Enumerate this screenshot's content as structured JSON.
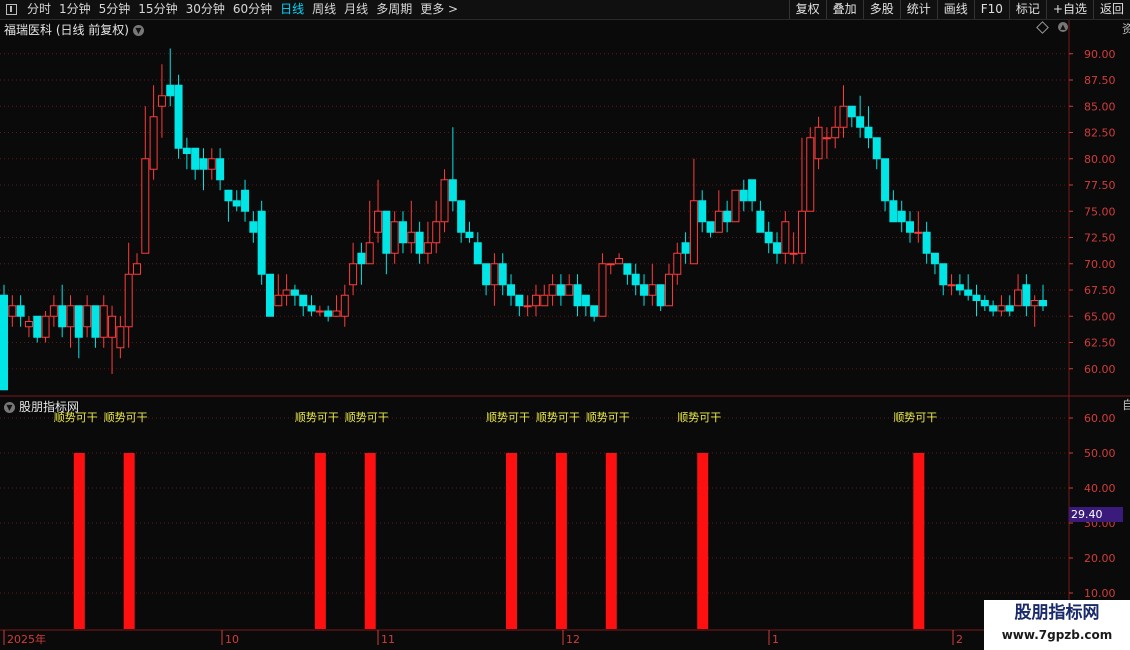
{
  "toolbar": {
    "periods": [
      "分时",
      "1分钟",
      "5分钟",
      "15分钟",
      "30分钟",
      "60分钟",
      "日线",
      "周线",
      "月线",
      "多周期",
      "更多 >"
    ],
    "active_period": "日线",
    "buttons": [
      "复权",
      "叠加",
      "多股",
      "统计",
      "画线",
      "F10",
      "标记",
      "+自选",
      "返回"
    ]
  },
  "chart_title": "福瑞医科 (日线 前复权)",
  "indicator_title": "股朋指标网",
  "current_value": "29.40",
  "side_text_top": "资",
  "side_text_bottom": "自",
  "watermark": {
    "title": "股朋指标网",
    "url": "www.7gpzb.com"
  },
  "colors": {
    "up": "#ff3b3b",
    "down": "#00e5e5",
    "grid": "#5a1a1a",
    "signal": "#ff1010",
    "signal_text": "#e8e84a"
  },
  "chart_data": [
    {
      "type": "candlestick",
      "title": "福瑞医科 (日线 前复权)",
      "y_ticks": [
        "90.00",
        "87.50",
        "85.00",
        "82.50",
        "80.00",
        "77.50",
        "75.00",
        "72.50",
        "70.00",
        "67.50",
        "65.00",
        "62.50",
        "60.00"
      ],
      "ylim": [
        57.5,
        91.5
      ],
      "x_ticks": [
        "2025年",
        "10",
        "11",
        "12",
        "1",
        "2"
      ],
      "candles": [
        [
          67,
          58,
          68,
          58
        ],
        [
          65,
          66,
          67,
          64
        ],
        [
          66,
          65,
          67,
          64
        ],
        [
          64,
          64.5,
          65,
          63
        ],
        [
          65,
          63,
          65,
          62.5
        ],
        [
          63,
          65,
          65.5,
          62.5
        ],
        [
          65,
          66,
          67,
          64
        ],
        [
          66,
          64,
          68,
          63
        ],
        [
          64,
          66,
          67,
          62
        ],
        [
          66,
          63,
          66,
          61
        ],
        [
          64,
          66,
          67,
          63
        ],
        [
          66,
          63,
          66,
          62
        ],
        [
          63,
          66,
          67,
          62
        ],
        [
          63,
          65,
          66,
          59.5
        ],
        [
          62,
          64,
          65,
          61
        ],
        [
          64,
          69,
          72,
          62
        ],
        [
          69,
          70,
          71,
          69
        ],
        [
          71,
          80,
          85,
          71
        ],
        [
          79,
          84,
          87,
          78
        ],
        [
          85,
          86,
          89,
          82
        ],
        [
          87,
          86,
          90.5,
          85
        ],
        [
          87,
          81,
          88,
          80
        ],
        [
          81,
          80.5,
          82,
          79
        ],
        [
          81,
          79,
          81,
          78
        ],
        [
          80,
          79,
          81,
          77
        ],
        [
          79,
          80,
          81,
          78
        ],
        [
          80,
          78,
          81,
          77
        ],
        [
          77,
          76,
          77,
          74
        ],
        [
          76,
          75.5,
          77,
          75
        ],
        [
          77,
          75,
          78,
          74
        ],
        [
          74,
          73,
          75,
          72
        ],
        [
          75,
          69,
          76,
          68
        ],
        [
          69,
          65,
          69,
          65
        ],
        [
          66,
          67,
          69,
          66
        ],
        [
          67,
          67.5,
          69,
          66
        ],
        [
          67.5,
          67,
          68,
          66
        ],
        [
          67,
          66,
          67,
          65
        ],
        [
          66,
          65.5,
          67,
          65
        ],
        [
          65.5,
          65.5,
          66,
          65
        ],
        [
          65.5,
          65,
          66,
          64.5
        ],
        [
          65,
          65.5,
          67,
          65
        ],
        [
          65,
          67,
          68,
          64
        ],
        [
          68,
          70,
          72,
          67
        ],
        [
          71,
          70,
          72,
          68
        ],
        [
          70,
          72,
          76,
          70
        ],
        [
          73,
          75,
          78,
          72
        ],
        [
          75,
          71,
          75,
          69
        ],
        [
          71,
          74,
          75,
          70
        ],
        [
          74,
          72,
          75,
          71
        ],
        [
          72,
          73,
          76,
          71
        ],
        [
          73,
          71,
          74,
          70
        ],
        [
          71,
          72,
          74,
          70
        ],
        [
          72,
          74,
          76,
          71
        ],
        [
          74,
          78,
          79,
          73
        ],
        [
          78,
          76,
          83,
          75
        ],
        [
          76,
          73,
          76,
          72
        ],
        [
          73,
          72.5,
          74,
          72
        ],
        [
          72,
          70,
          73,
          70
        ],
        [
          70,
          68,
          70,
          67
        ],
        [
          68,
          70,
          71,
          66
        ],
        [
          70,
          68,
          71,
          67
        ],
        [
          68,
          67,
          69,
          66
        ],
        [
          67,
          66,
          67,
          65
        ],
        [
          66,
          66,
          67,
          65
        ],
        [
          66,
          67,
          68,
          65
        ],
        [
          66,
          67,
          68,
          66
        ],
        [
          67,
          68,
          69,
          66
        ],
        [
          68,
          67,
          69,
          66
        ],
        [
          67,
          68,
          69,
          67
        ],
        [
          68,
          66,
          69,
          65
        ],
        [
          67,
          66,
          67,
          65
        ],
        [
          66,
          65,
          66,
          64.5
        ],
        [
          65,
          70,
          71,
          65
        ],
        [
          70,
          70,
          70,
          69
        ],
        [
          70,
          70.5,
          71,
          70
        ],
        [
          70,
          69,
          70,
          68
        ],
        [
          69,
          68,
          70,
          67
        ],
        [
          68,
          67,
          69,
          66
        ],
        [
          67,
          68,
          70,
          66
        ],
        [
          68,
          66,
          68,
          65.5
        ],
        [
          66,
          69,
          70,
          66
        ],
        [
          69,
          71,
          72,
          68
        ],
        [
          72,
          71,
          73,
          70
        ],
        [
          70,
          76,
          80,
          70
        ],
        [
          76,
          74,
          77,
          73
        ],
        [
          74,
          73,
          74,
          72.5
        ],
        [
          73,
          75,
          77,
          73
        ],
        [
          75,
          74,
          76,
          73
        ],
        [
          74,
          77,
          77,
          74
        ],
        [
          77,
          76,
          78,
          75
        ],
        [
          78,
          76,
          77,
          75
        ],
        [
          75,
          73,
          76,
          73
        ],
        [
          73,
          72,
          74,
          71
        ],
        [
          72,
          71,
          73,
          70
        ],
        [
          71,
          74,
          75,
          70
        ],
        [
          71,
          71,
          73,
          70
        ],
        [
          71,
          75,
          82,
          70
        ],
        [
          75,
          82,
          83,
          77
        ],
        [
          80,
          83,
          84,
          79
        ],
        [
          82,
          82,
          83,
          80
        ],
        [
          82,
          83,
          85,
          81
        ],
        [
          83,
          85,
          87,
          82
        ],
        [
          85,
          84,
          85,
          83
        ],
        [
          84,
          83,
          86,
          82
        ],
        [
          83,
          82,
          85,
          81
        ],
        [
          82,
          80,
          82,
          79
        ],
        [
          80,
          76,
          80,
          75
        ],
        [
          76,
          74,
          77,
          74
        ],
        [
          75,
          74,
          76,
          73
        ],
        [
          74,
          73,
          75,
          72
        ],
        [
          73,
          73,
          75,
          72
        ],
        [
          73,
          71,
          74,
          70
        ],
        [
          71,
          70,
          71,
          69
        ],
        [
          70,
          68,
          70,
          67
        ],
        [
          68,
          68,
          69,
          67
        ],
        [
          68,
          67.5,
          69,
          67
        ],
        [
          67.5,
          67,
          69,
          66.5
        ],
        [
          67,
          66.5,
          68,
          65
        ],
        [
          66.5,
          66,
          67,
          65.5
        ],
        [
          66,
          65.5,
          66.5,
          65
        ],
        [
          65.5,
          66,
          67,
          65
        ],
        [
          66,
          65.5,
          67,
          65
        ],
        [
          66,
          67.5,
          69,
          66
        ],
        [
          68,
          66,
          69,
          65
        ],
        [
          66,
          66.5,
          67,
          64
        ],
        [
          66.5,
          66,
          68,
          65.5
        ]
      ]
    },
    {
      "type": "bar",
      "title": "股朋指标网",
      "y_ticks": [
        "60.00",
        "50.00",
        "40.00",
        "30.00",
        "20.00",
        "10.00"
      ],
      "ylim": [
        0,
        64
      ],
      "signal_label": "顺势可干",
      "signal_indices": [
        9,
        15,
        38,
        44,
        61,
        67,
        73,
        84,
        110
      ],
      "values": [
        50,
        50,
        50,
        50,
        50,
        50,
        50,
        50,
        50
      ]
    }
  ]
}
